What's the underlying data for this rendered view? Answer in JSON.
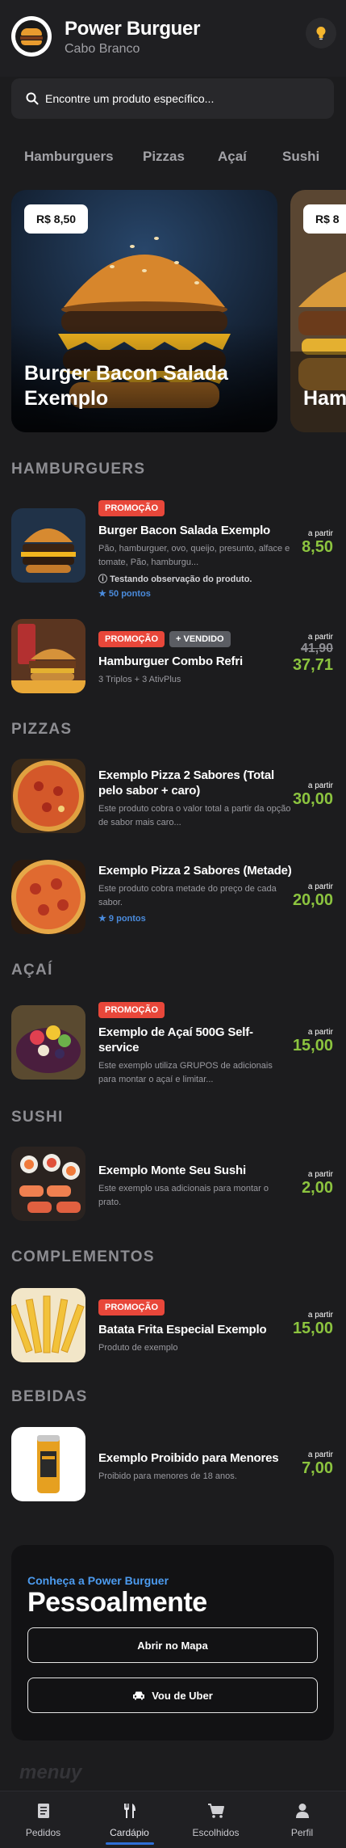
{
  "store": {
    "name": "Power Burguer",
    "location": "Cabo Branco"
  },
  "search": {
    "placeholder": "Encontre um produto específico..."
  },
  "categories": [
    "Hamburguers",
    "Pizzas",
    "Açaí",
    "Sushi"
  ],
  "featured": [
    {
      "price": "R$ 8,50",
      "title": "Burger Bacon Salada Exemplo"
    },
    {
      "price": "R$ 8",
      "title": "Ham"
    }
  ],
  "labels": {
    "promo": "PROMOÇÃO",
    "vendido": "+ VENDIDO",
    "from": "a partir"
  },
  "sections": {
    "hamburguers": {
      "title": "HAMBURGUERS",
      "items": [
        {
          "name": "Burger Bacon Salada Exemplo",
          "desc": "Pão, hamburguer, ovo, queijo, presunto, alface e tomate, Pão, hamburgu...",
          "obs": "Testando observação do produto.",
          "points": "50 pontos",
          "price": "8,50"
        },
        {
          "name": "Hamburguer Combo Refri",
          "desc": "3 Triplos + 3 AtivPlus",
          "old_price": "41,90",
          "price": "37,71"
        }
      ]
    },
    "pizzas": {
      "title": "PIZZAS",
      "items": [
        {
          "name": "Exemplo Pizza 2 Sabores (Total pelo sabor + caro)",
          "desc": "Este produto cobra o valor total a partir da opção de sabor mais caro...",
          "price": "30,00"
        },
        {
          "name": "Exemplo Pizza 2 Sabores (Metade)",
          "desc": "Este produto cobra metade do preço de cada sabor.",
          "points": "9 pontos",
          "price": "20,00"
        }
      ]
    },
    "acai": {
      "title": "AÇAÍ",
      "items": [
        {
          "name": "Exemplo de Açaí 500G Self-service",
          "desc": "Este exemplo utiliza GRUPOS de adicionais para montar o açaí e limitar...",
          "price": "15,00"
        }
      ]
    },
    "sushi": {
      "title": "SUSHI",
      "items": [
        {
          "name": "Exemplo Monte Seu Sushi",
          "desc": "Este exemplo usa adicionais para montar o prato.",
          "price": "2,00"
        }
      ]
    },
    "complementos": {
      "title": "COMPLEMENTOS",
      "items": [
        {
          "name": "Batata Frita Especial Exemplo",
          "desc": "Produto de exemplo",
          "price": "15,00"
        }
      ]
    },
    "bebidas": {
      "title": "BEBIDAS",
      "items": [
        {
          "name": "Exemplo Proibido para Menores",
          "desc": "Proibido para menores de 18 anos.",
          "price": "7,00"
        }
      ]
    }
  },
  "visit": {
    "kicker": "Conheça a Power Burguer",
    "title": "Pessoalmente",
    "map_btn": "Abrir no Mapa",
    "uber_btn": "Vou de Uber"
  },
  "watermark": "menuy",
  "nav": [
    "Pedidos",
    "Cardápio",
    "Escolhidos",
    "Perfil"
  ],
  "colors": {
    "accent_green": "#8cc43f",
    "promo_red": "#e8473a",
    "nav_active": "#2f6fd6",
    "points_blue": "#4a8bdc"
  }
}
